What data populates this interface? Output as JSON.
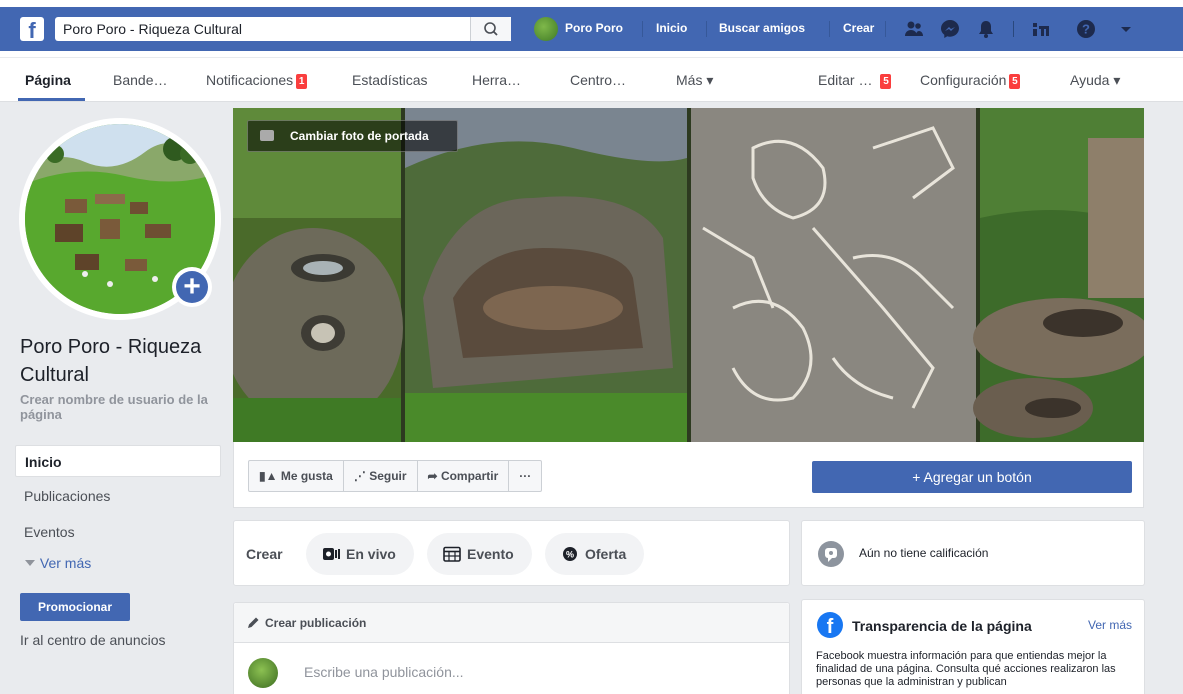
{
  "topbar": {
    "search_value": "Poro Poro - Riqueza Cultural",
    "profile_name": "Poro Poro",
    "links": [
      "Inicio",
      "Buscar amigos",
      "Crear"
    ]
  },
  "tabs": {
    "items": [
      {
        "label": "Página"
      },
      {
        "label": "Bande…"
      },
      {
        "label": "Notificaciones",
        "badge": "1"
      },
      {
        "label": "Estadísticas"
      },
      {
        "label": "Herra…"
      },
      {
        "label": "Centro…"
      },
      {
        "label": "Más ▾"
      },
      {
        "label": "Editar …",
        "badge": "5"
      },
      {
        "label": "Configuración",
        "badge": "5"
      },
      {
        "label": "Ayuda ▾"
      }
    ]
  },
  "sidebar": {
    "page_name": "Poro Poro - Riqueza Cultural",
    "username_link": "Crear nombre de usuario de la página",
    "nav": [
      "Inicio",
      "Publicaciones",
      "Eventos"
    ],
    "more": "Ver más",
    "promote": "Promocionar",
    "ads_center": "Ir al centro de anuncios"
  },
  "cover": {
    "change_label": "Cambiar foto de portada"
  },
  "actions": {
    "like": "Me gusta",
    "follow": "Seguir",
    "share": "Compartir",
    "more": "···",
    "add_button": "+ Agregar un botón"
  },
  "create": {
    "label": "Crear",
    "live": "En vivo",
    "event": "Evento",
    "offer": "Oferta"
  },
  "rating": {
    "text": "Aún no tiene calificación"
  },
  "transparency": {
    "title": "Transparencia de la página",
    "more": "Ver más",
    "body": "Facebook muestra información para que entiendas mejor la finalidad de una página. Consulta qué acciones realizaron las personas que la administran y publican"
  },
  "post": {
    "header": "Crear publicación",
    "placeholder": "Escribe una publicación..."
  }
}
